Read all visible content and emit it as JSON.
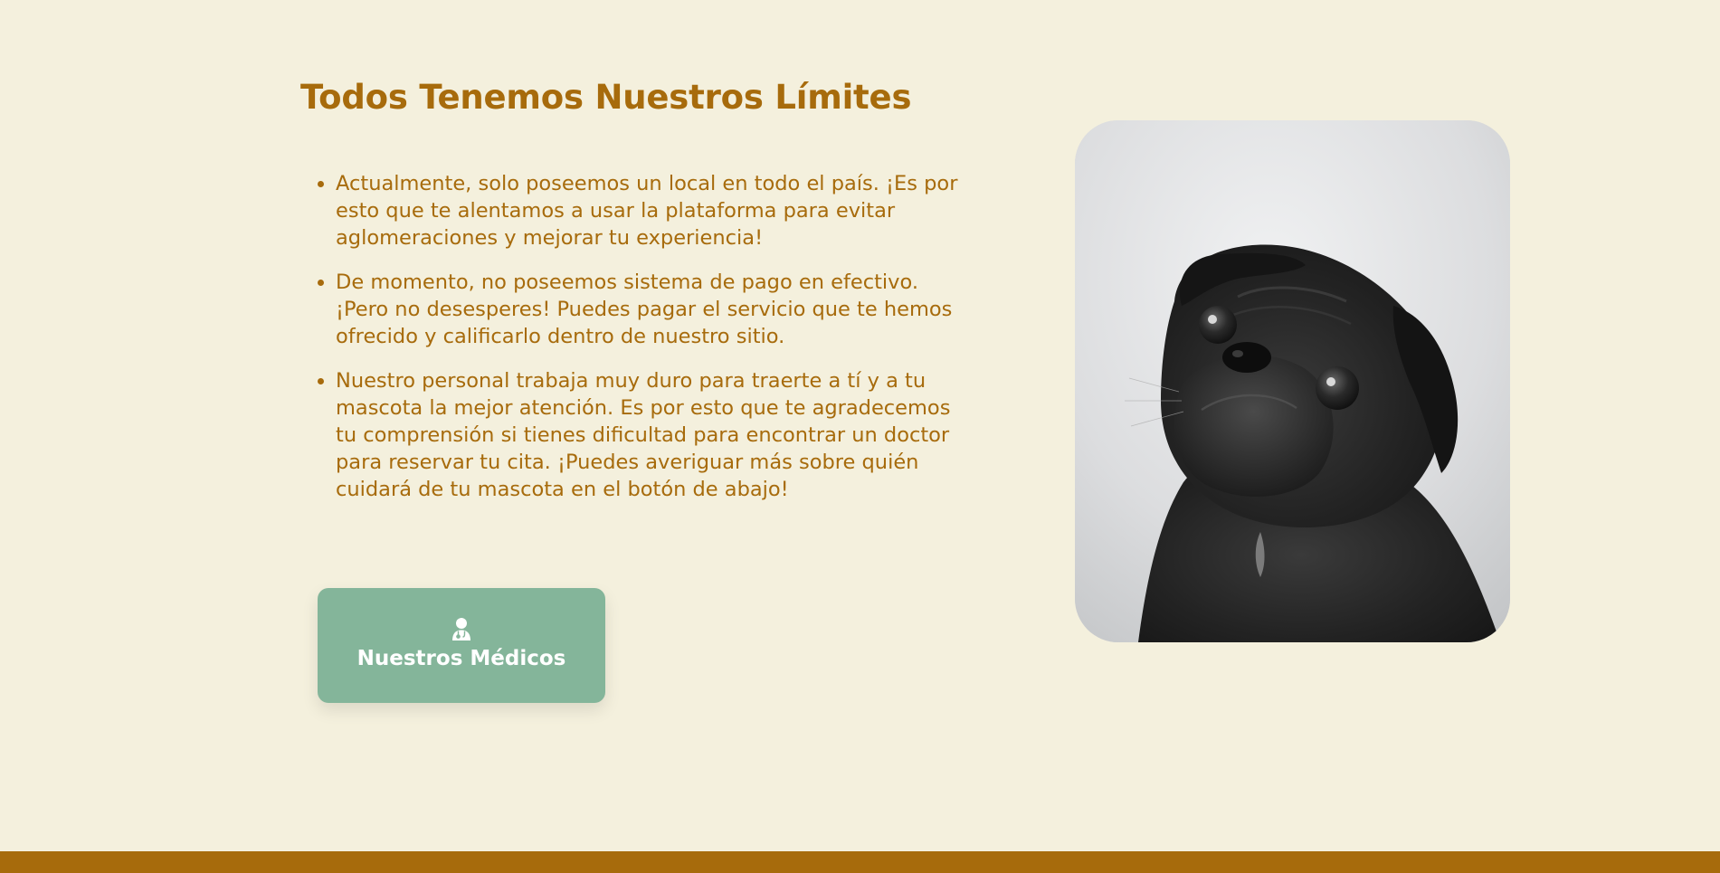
{
  "section": {
    "title": "Todos Tenemos Nuestros Límites",
    "items": [
      "Actualmente, solo poseemos un local en todo el país. ¡Es por esto que te alentamos a usar la plataforma para evitar aglomeraciones y mejorar tu experiencia!",
      "De momento, no poseemos sistema de pago en efectivo. ¡Pero no desesperes! Puedes pagar el servicio que te hemos ofrecido y calificarlo dentro de nuestro sitio.",
      "Nuestro personal trabaja muy duro para traerte a tí y a tu mascota la mejor atención. Es por esto que te agradecemos tu comprensión si tienes dificultad para encontrar un doctor para reservar tu cita. ¡Puedes averiguar más sobre quién cuidará de tu mascota en el botón de abajo!"
    ],
    "button": {
      "label": "Nuestros Médicos",
      "icon": "doctor-icon"
    },
    "image": {
      "subject": "pug-photo"
    }
  },
  "colors": {
    "background": "#f4f0dd",
    "text_accent": "#a76b0c",
    "button": "#84b59a",
    "footer": "#a76b0c"
  }
}
